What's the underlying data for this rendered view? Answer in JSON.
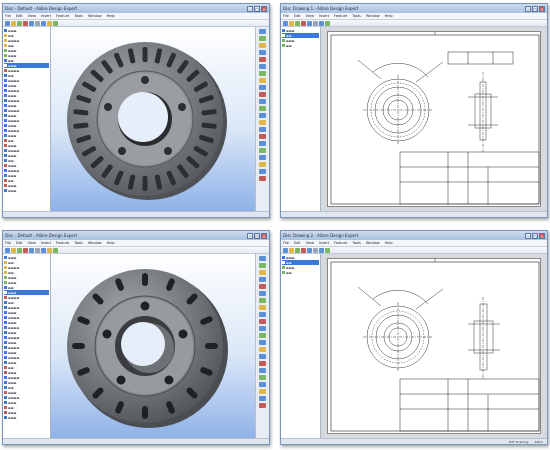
{
  "windows": [
    {
      "title": "Disc - Default - Alibre Design Expert",
      "statusbar": [
        "",
        ""
      ]
    },
    {
      "title": "Disc Drawing 1 - Alibre Design Expert",
      "statusbar": [
        "",
        ""
      ]
    },
    {
      "title": "Disc - Default - Alibre Design Expert",
      "statusbar": [
        "",
        ""
      ]
    },
    {
      "title": "Disc Drawing 2 - Alibre Design Expert",
      "statusbar": [
        "DXF Drawing",
        "100%"
      ]
    }
  ],
  "menu": [
    "File",
    "Edit",
    "View",
    "Insert",
    "Feature",
    "Tools",
    "Window",
    "Help"
  ],
  "colors": {
    "title_gradient": [
      "#cfdcef",
      "#a9c0e0"
    ],
    "viewport_gradient": [
      "#ffffff",
      "#8fb2e8"
    ],
    "disc_gray": "#7d8085",
    "selection": "#3b78d8"
  },
  "icons": [
    "minimize-icon",
    "maximize-icon",
    "close-icon",
    "tree-node-icon",
    "tool-icon"
  ]
}
